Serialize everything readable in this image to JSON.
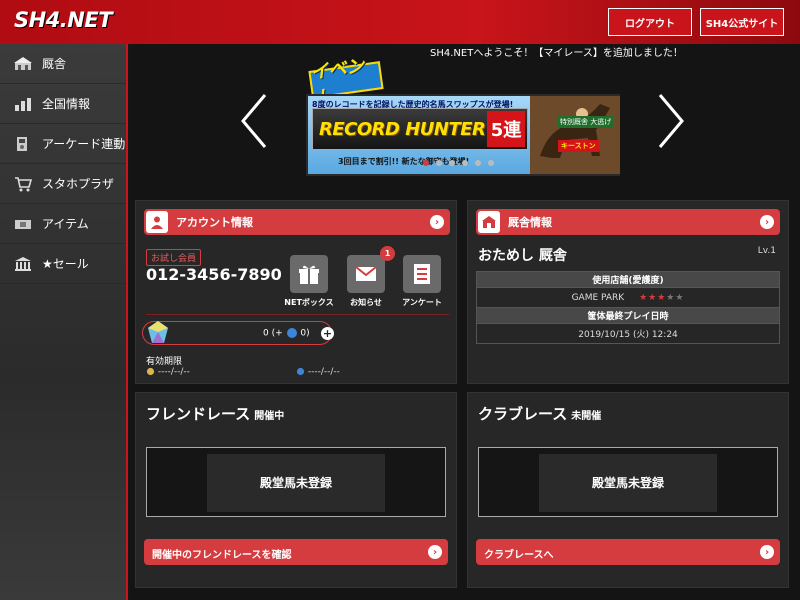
{
  "header": {
    "logo": "SH4.NET",
    "logout_label": "ログアウト",
    "site_label": "SH4公式サイト"
  },
  "sidebar": {
    "items": [
      {
        "label": "厩舎",
        "icon": "stable-icon"
      },
      {
        "label": "全国情報",
        "icon": "ranking-icon"
      },
      {
        "label": "アーケード連動",
        "icon": "arcade-icon"
      },
      {
        "label": "スタホプラザ",
        "icon": "cart-icon"
      },
      {
        "label": "アイテム",
        "icon": "ticket-icon"
      },
      {
        "label": "★セール",
        "icon": "bank-icon"
      }
    ]
  },
  "welcome": "SH4.NETへようこそ！【マイレース】を追加しました！",
  "banner": {
    "event_label": "イベント",
    "line1": "8度のレコードを記録した歴史的名馬スワップスが登場!",
    "main_title": "RECORD HUNTER",
    "main_suffix": "5連",
    "line2": "3回目まで割引!! 新たな御守も登場!",
    "tag1": "特別厩舎 大逃げ",
    "tag2": "キーストン",
    "dots_total": 6,
    "dots_active": 0
  },
  "account": {
    "header_label": "アカウント情報",
    "trial_badge": "お試し会員",
    "member_id": "012-3456-7890",
    "tiles": [
      {
        "label": "NETボックス",
        "icon": "gift-icon"
      },
      {
        "label": "お知らせ",
        "icon": "mail-icon"
      },
      {
        "label": "アンケート",
        "icon": "survey-icon"
      }
    ],
    "notification_count": "1",
    "coin_text": "0 (+",
    "coin_bonus": "0)",
    "expire_label": "有効期限",
    "expire_value1": "----/--/--",
    "expire_value2": "----/--/--"
  },
  "stable": {
    "header_label": "厩舎情報",
    "name": "おためし 厩舎",
    "level": "Lv.1",
    "store_header": "使用店舗(愛護度)",
    "store_name": "GAME PARK",
    "store_stars_on": "★★★",
    "store_stars_off": "★★",
    "last_play_header": "筐体最終プレイ日時",
    "last_play_value": "2019/10/15 (火) 12:24"
  },
  "friend_race": {
    "title": "フレンドレース",
    "status": "開催中",
    "box_text": "殿堂馬未登録",
    "button_label": "開催中のフレンドレースを確認"
  },
  "club_race": {
    "title": "クラブレース",
    "status": "未開催",
    "box_text": "殿堂馬未登録",
    "button_label": "クラブレースへ"
  },
  "colors": {
    "accent": "#d53c40",
    "header": "#c8141a"
  }
}
